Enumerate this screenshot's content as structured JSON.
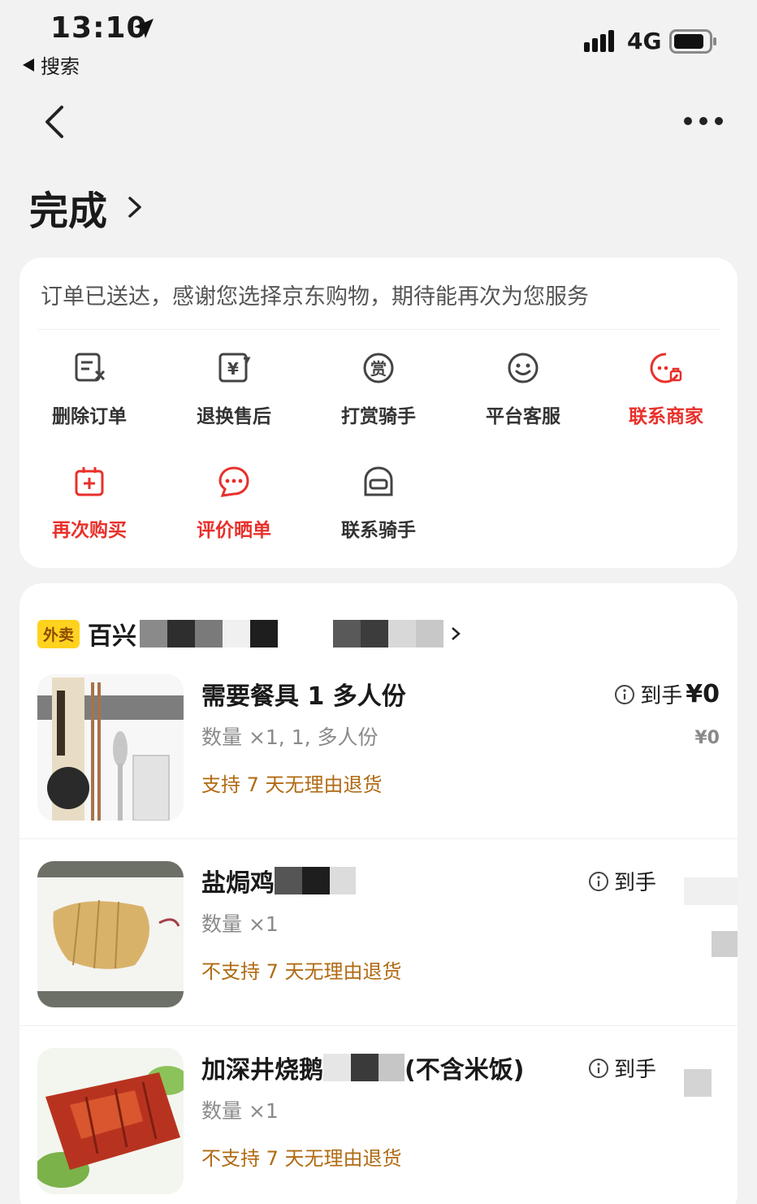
{
  "status_bar": {
    "time": "13:10",
    "back_app_label": "搜索",
    "network": "4G",
    "icons": [
      "location-arrow-icon",
      "signal-icon",
      "battery-icon"
    ]
  },
  "nav": {
    "icons": [
      "back-chevron-icon",
      "more-dots-icon"
    ]
  },
  "order": {
    "status_title": "完成",
    "status_message": "订单已送达，感谢您选择京东购物，期待能再次为您服务"
  },
  "actions": [
    {
      "label": "删除订单",
      "icon": "delete-order-icon",
      "highlight": false
    },
    {
      "label": "退换售后",
      "icon": "refund-icon",
      "highlight": false
    },
    {
      "label": "打赏骑手",
      "icon": "reward-icon",
      "highlight": false
    },
    {
      "label": "平台客服",
      "icon": "customer-service-icon",
      "highlight": false
    },
    {
      "label": "联系商家",
      "icon": "contact-merchant-icon",
      "highlight": true
    },
    {
      "label": "再次购买",
      "icon": "buy-again-icon",
      "highlight": true
    },
    {
      "label": "评价晒单",
      "icon": "review-icon",
      "highlight": true
    },
    {
      "label": "联系骑手",
      "icon": "contact-rider-icon",
      "highlight": false
    }
  ],
  "shop": {
    "badge": "外卖",
    "name": "百兴"
  },
  "items": [
    {
      "name": "需要餐具 1 多人份",
      "qty": "数量 ×1, 1, 多人份",
      "return_policy": "支持 7 天无理由退货",
      "price_label": "到手",
      "price": "¥0",
      "price_sub": "¥0"
    },
    {
      "name": "盐焗鸡",
      "qty": "数量 ×1",
      "return_policy": "不支持 7 天无理由退货",
      "price_label": "到手",
      "price": "",
      "price_sub": ""
    },
    {
      "name": "加深井烧鹅",
      "name_suffix": "(不含米饭)",
      "qty": "数量 ×1",
      "return_policy": "不支持 7 天无理由退货",
      "price_label": "到手",
      "price": "",
      "price_sub": ""
    }
  ],
  "colors": {
    "accent_red": "#e8302b",
    "badge_yellow": "#ffd21e",
    "return_brown": "#b06a12",
    "background": "#f2f2f2"
  }
}
